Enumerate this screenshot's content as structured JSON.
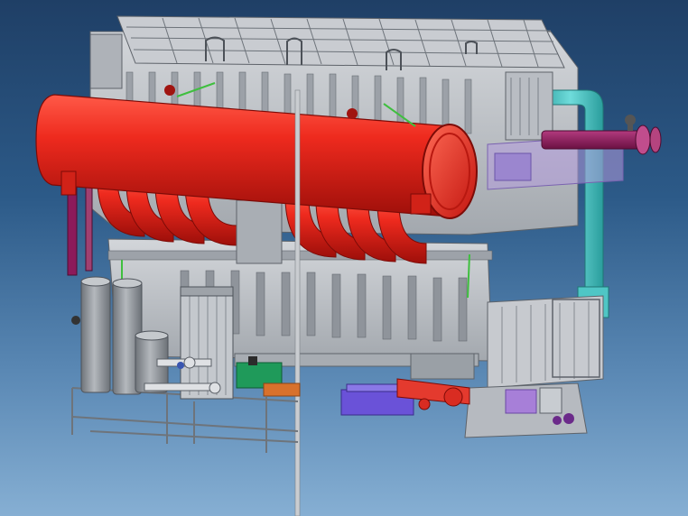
{
  "scene": {
    "kind": "3d-cad-render",
    "subject": "absorption-chiller-unit",
    "colors": {
      "background_top": "#1f3f66",
      "background_bottom": "#86afd3",
      "frame_gray": "#b9bdc3",
      "frame_dark": "#7b8088",
      "header_red": "#e0231b",
      "header_red_dark": "#a9110c",
      "pipe_teal": "#3fc0bf",
      "pipe_purple": "#8c1a5a",
      "pump_blue": "#6a52d8",
      "tank_gray": "#8e9298",
      "bracket_violet": "#a48ad6",
      "green_pump": "#1f9a5a",
      "orange_fitting": "#d8712c"
    },
    "icons": [
      "lifting-lug-icon",
      "flange-icon",
      "valve-icon",
      "pump-icon"
    ]
  }
}
